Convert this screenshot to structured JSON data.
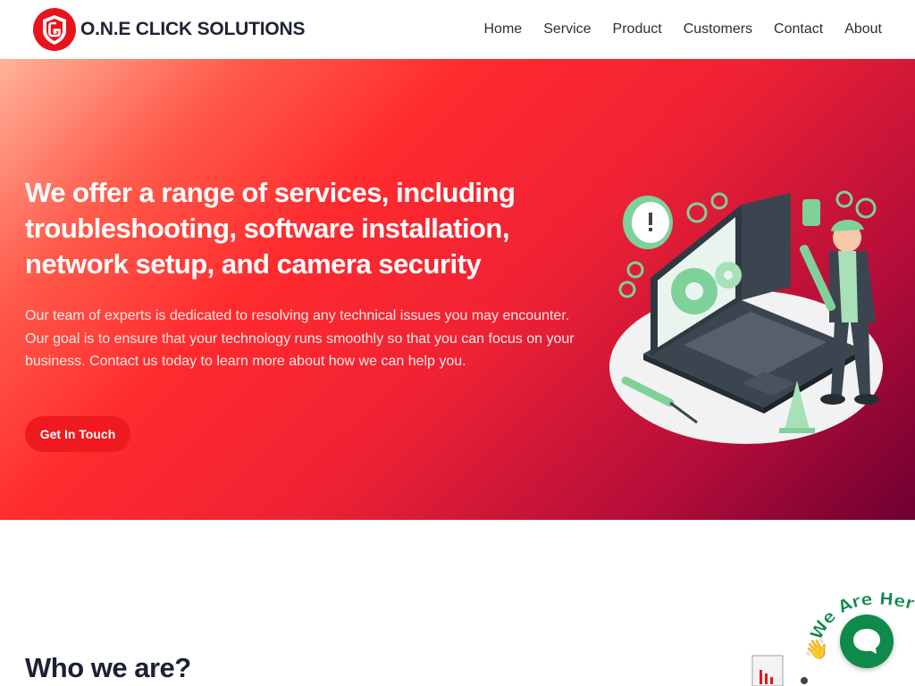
{
  "brand": {
    "name": "O.N.E CLICK SOLUTIONS",
    "accent": "#e8141c"
  },
  "nav": {
    "items": [
      "Home",
      "Service",
      "Product",
      "Customers",
      "Contact",
      "About"
    ]
  },
  "hero": {
    "title": "We offer a range of services, including troubleshooting, software installation, network setup, and camera security",
    "text": "Our team of experts is dedicated to resolving any technical issues you may encounter. Our goal is to ensure that your technology runs smoothly so that you can focus on your business. Contact us today to learn more about how we can help you.",
    "button": "Get In Touch",
    "illustration_icon": "technician-laptop-illustration"
  },
  "who": {
    "title": "Who we are?"
  },
  "chat": {
    "badge_text": "We Are Here!",
    "icon": "chat-bubble-icon",
    "color": "#0e8a4a"
  }
}
